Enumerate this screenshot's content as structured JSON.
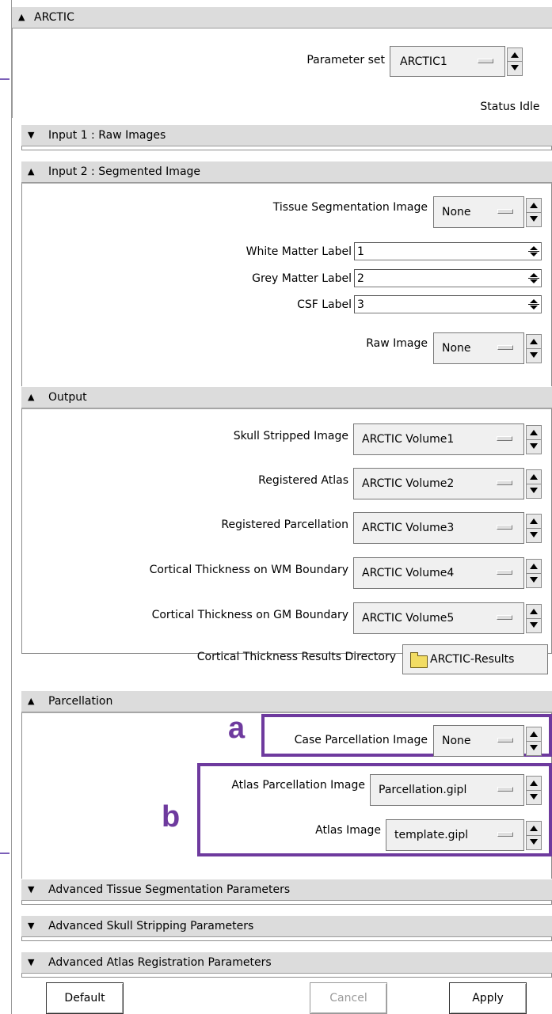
{
  "colors": {
    "accent": "#6e3a9e",
    "section_header_bg": "#dcdcdc",
    "folder": "#f2dc63"
  },
  "icons": {
    "collapse": "triangle-up-icon",
    "expand": "triangle-down-icon",
    "folder": "folder-icon",
    "spinner": "up-down-arrows-icon"
  },
  "top": {
    "title": "ARCTIC",
    "parameter_set_label": "Parameter set",
    "parameter_set_value": "ARCTIC1",
    "status_label": "Status",
    "status_value": "Idle"
  },
  "input1": {
    "title": "Input 1 : Raw Images"
  },
  "input2": {
    "title": "Input 2 : Segmented Image",
    "tissue_label": "Tissue Segmentation Image",
    "tissue_value": "None",
    "wm_label": "White Matter Label",
    "wm_value": "1",
    "gm_label": "Grey Matter Label",
    "gm_value": "2",
    "csf_label": "CSF Label",
    "csf_value": "3",
    "raw_label": "Raw Image",
    "raw_value": "None"
  },
  "output": {
    "title": "Output",
    "rows": [
      {
        "label": "Skull Stripped Image",
        "value": "ARCTIC Volume1"
      },
      {
        "label": "Registered Atlas",
        "value": "ARCTIC Volume2"
      },
      {
        "label": "Registered Parcellation",
        "value": "ARCTIC Volume3"
      },
      {
        "label": "Cortical Thickness on WM Boundary",
        "value": "ARCTIC Volume4"
      },
      {
        "label": "Cortical Thickness on GM Boundary",
        "value": "ARCTIC Volume5"
      }
    ],
    "results_dir_label": "Cortical Thickness Results Directory",
    "results_dir_value": "ARCTIC-Results"
  },
  "parcellation": {
    "title": "Parcellation",
    "callout_a": "a",
    "callout_b": "b",
    "case_label": "Case Parcellation Image",
    "case_value": "None",
    "atlas_parc_label": "Atlas Parcellation Image",
    "atlas_parc_value": "Parcellation.gipl",
    "atlas_image_label": "Atlas Image",
    "atlas_image_value": "template.gipl"
  },
  "advanced": {
    "tissue_title": "Advanced Tissue Segmentation Parameters",
    "skull_title": "Advanced Skull Stripping Parameters",
    "atlas_title": "Advanced Atlas Registration Parameters"
  },
  "buttons": {
    "default_label": "Default",
    "cancel_label": "Cancel",
    "apply_label": "Apply"
  }
}
